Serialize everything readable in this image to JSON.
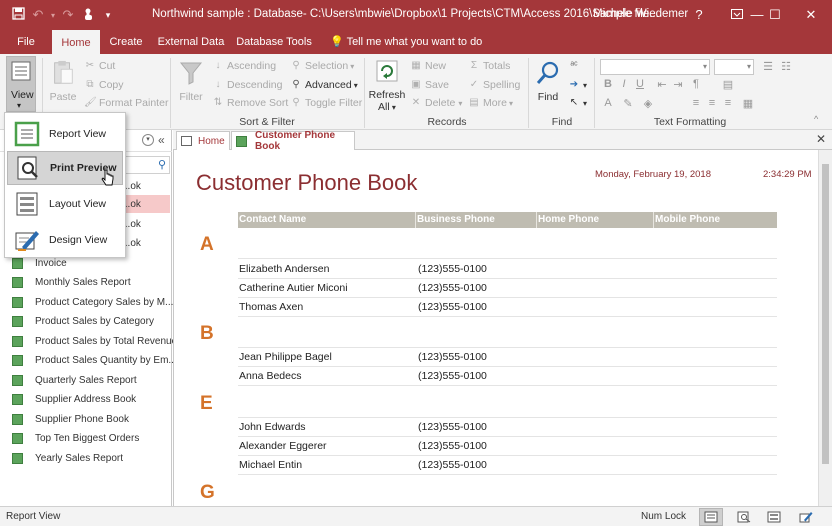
{
  "window": {
    "title": "Northwind sample : Database- C:\\Users\\mbwie\\Dropbox\\1 Projects\\CTM\\Access 2016\\Sample file...",
    "user": "Michele Wiedemer",
    "help": "?",
    "accent": "#a4373a"
  },
  "ribbon_tabs": [
    {
      "label": "File"
    },
    {
      "label": "Home"
    },
    {
      "label": "Create"
    },
    {
      "label": "External Data"
    },
    {
      "label": "Database Tools"
    }
  ],
  "tell_me": "Tell me what you want to do",
  "ribbon": {
    "views": {
      "view_label": "View"
    },
    "clipboard": {
      "paste": "Paste",
      "cut": "Cut",
      "copy": "Copy",
      "format_painter": "Format Painter"
    },
    "sort_filter": {
      "label": "Sort & Filter",
      "filter": "Filter",
      "ascending": "Ascending",
      "descending": "Descending",
      "remove_sort": "Remove Sort",
      "selection": "Selection",
      "advanced": "Advanced",
      "toggle_filter": "Toggle Filter"
    },
    "records": {
      "label": "Records",
      "refresh": "Refresh",
      "refresh_all": "All",
      "new": "New",
      "save": "Save",
      "delete": "Delete",
      "totals": "Totals",
      "spelling": "Spelling",
      "more": "More"
    },
    "find": {
      "label": "Find",
      "find": "Find"
    },
    "text_formatting": {
      "label": "Text Formatting"
    }
  },
  "view_menu": [
    {
      "label": "Report View"
    },
    {
      "label": "Print Preview"
    },
    {
      "label": "Layout View"
    },
    {
      "label": "Design View"
    }
  ],
  "nav_pane": {
    "items": [
      {
        "label": "...ok"
      },
      {
        "label": "...ok"
      },
      {
        "label": "...ok"
      },
      {
        "label": "...ok"
      },
      {
        "label": "Invoice"
      },
      {
        "label": "Monthly Sales Report"
      },
      {
        "label": "Product Category Sales by M..."
      },
      {
        "label": "Product Sales by Category"
      },
      {
        "label": "Product Sales by Total Revenue"
      },
      {
        "label": "Product Sales Quantity by Em..."
      },
      {
        "label": "Quarterly Sales Report"
      },
      {
        "label": "Supplier Address Book"
      },
      {
        "label": "Supplier Phone Book"
      },
      {
        "label": "Top Ten Biggest Orders"
      },
      {
        "label": "Yearly Sales Report"
      }
    ]
  },
  "doc_tabs": [
    {
      "label": "Home"
    },
    {
      "label": "Customer Phone Book"
    }
  ],
  "report": {
    "title": "Customer Phone Book",
    "date": "Monday, February 19, 2018",
    "time": "2:34:29 PM",
    "columns": [
      "Contact Name",
      "Business Phone",
      "Home Phone",
      "Mobile Phone"
    ],
    "groups": [
      {
        "letter": "A",
        "rows": [
          {
            "name": "Elizabeth Andersen",
            "phone": "(123)555-0100"
          },
          {
            "name": "Catherine Autier Miconi",
            "phone": "(123)555-0100"
          },
          {
            "name": "Thomas Axen",
            "phone": "(123)555-0100"
          }
        ]
      },
      {
        "letter": "B",
        "rows": [
          {
            "name": "Jean Philippe Bagel",
            "phone": "(123)555-0100"
          },
          {
            "name": "Anna Bedecs",
            "phone": "(123)555-0100"
          }
        ]
      },
      {
        "letter": "E",
        "rows": [
          {
            "name": "John Edwards",
            "phone": "(123)555-0100"
          },
          {
            "name": "Alexander Eggerer",
            "phone": "(123)555-0100"
          },
          {
            "name": "Michael Entin",
            "phone": "(123)555-0100"
          }
        ]
      },
      {
        "letter": "G",
        "rows": []
      }
    ]
  },
  "status": {
    "left": "Report View",
    "num_lock": "Num Lock"
  }
}
